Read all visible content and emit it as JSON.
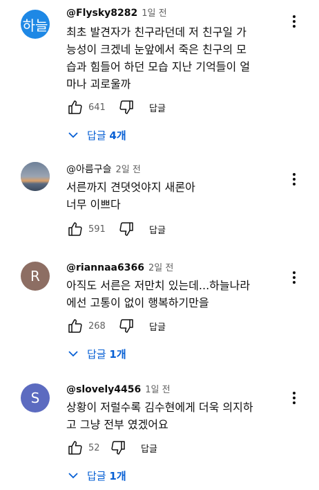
{
  "comments": [
    {
      "avatar_text": "하늘",
      "avatar_color": "#1e88e5",
      "handle": "@Flysky8282",
      "time": "1일 전",
      "lines": [
        "최초 발견자가 친구라던데 저 친구일 가",
        "능성이 크겠네 눈앞에서 죽은 친구의 모",
        "습과 힘들어 하던 모습 지난 기억들이 얼",
        "마나 괴로울까"
      ],
      "likes": "641",
      "reply_label": "답글",
      "replies_prefix": "답글",
      "replies_count": "4개"
    },
    {
      "avatar_text": "",
      "avatar_color": "#6b7a8f",
      "handle": "@아름구슬",
      "time": "2일 전",
      "lines": [
        "서른까지 견뎟엇야지 새론아",
        "너무 이쁘다"
      ],
      "likes": "591",
      "reply_label": "답글"
    },
    {
      "avatar_text": "R",
      "avatar_color": "#8d6e63",
      "handle": "@riannaa6366",
      "time": "2일 전",
      "lines": [
        "아직도 서른은 저만치 있는데...하늘나라",
        "에선 고통이 없이 행복하기만을"
      ],
      "likes": "268",
      "reply_label": "답글",
      "replies_prefix": "답글",
      "replies_count": "1개"
    },
    {
      "avatar_text": "S",
      "avatar_color": "#5c6bc0",
      "handle": "@slovely4456",
      "time": "1일 전",
      "lines": [
        "상황이 저럴수록 김수현에게 더욱 의지하",
        "고 그냥 전부 였겠어요"
      ],
      "likes": "52",
      "reply_label": "답글",
      "replies_prefix": "답글",
      "replies_count": "1개"
    }
  ]
}
